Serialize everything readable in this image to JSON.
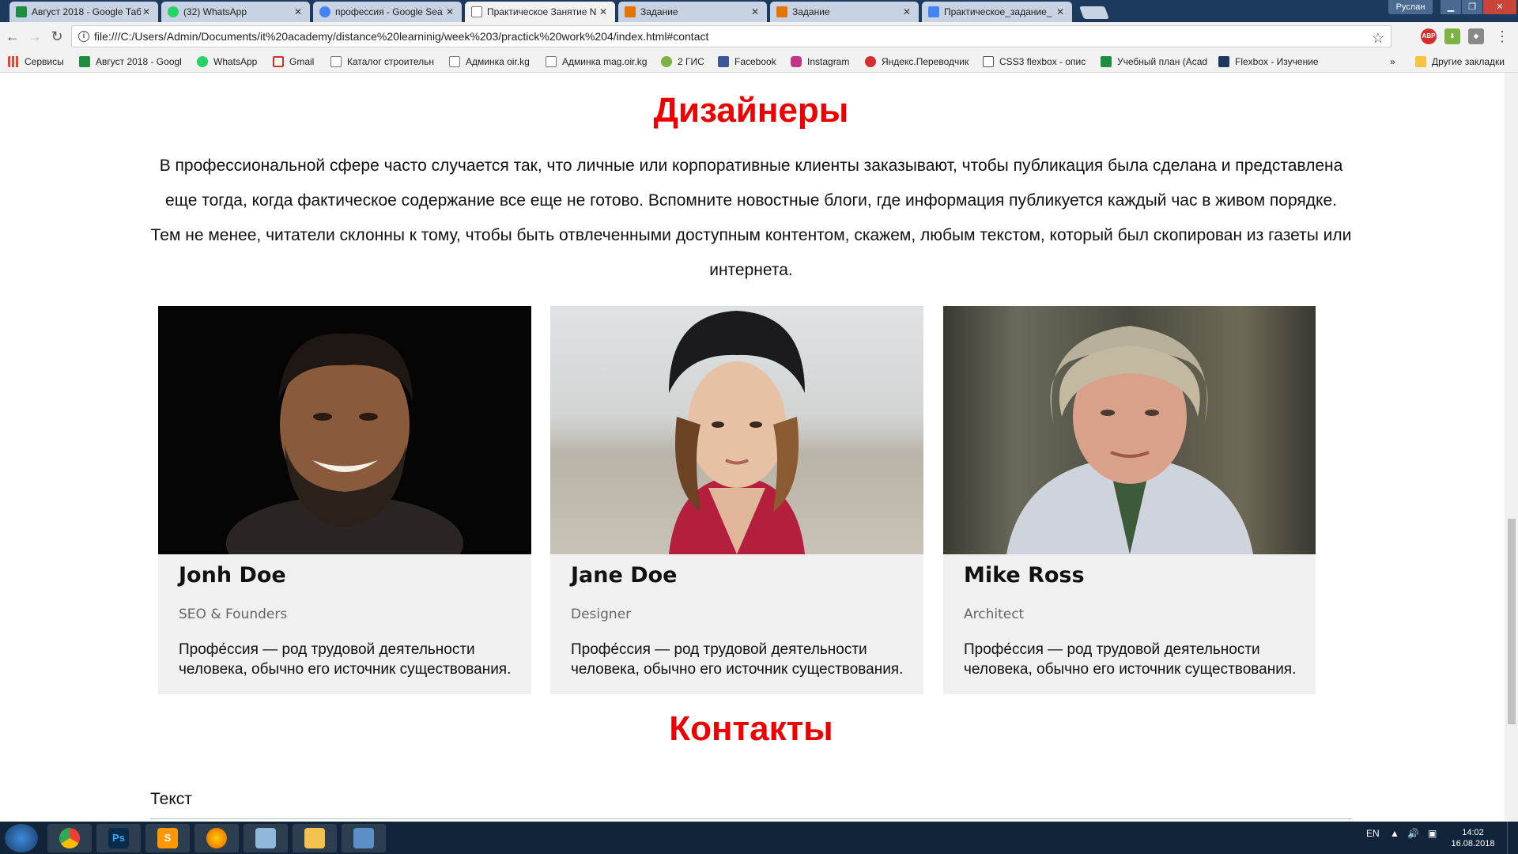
{
  "browser": {
    "tabs": [
      {
        "label": "Август 2018 - Google Таб",
        "favicon_color": "#1e8e3e"
      },
      {
        "label": "(32) WhatsApp",
        "favicon_color": "#25d366"
      },
      {
        "label": "профессия - Google Sea",
        "favicon_color": "#4285f4"
      },
      {
        "label": "Практическое Занятие N",
        "favicon_color": "#9aa0a6"
      },
      {
        "label": "Задание",
        "favicon_color": "#e37400"
      },
      {
        "label": "Задание",
        "favicon_color": "#e37400"
      },
      {
        "label": "Практическое_задание_",
        "favicon_color": "#4285f4"
      }
    ],
    "user": "Руслан",
    "url": "file:///C:/Users/Admin/Documents/it%20academy/distance%20learninig/week%203/practick%20work%204/index.html#contact",
    "bookmarks": [
      {
        "label": "Сервисы",
        "icon_color": "#ea4335"
      },
      {
        "label": "Август 2018 - Googl",
        "icon_color": "#1e8e3e"
      },
      {
        "label": "WhatsApp",
        "icon_color": "#25d366"
      },
      {
        "label": "Gmail",
        "icon_color": "#d93025"
      },
      {
        "label": "Каталог строительн",
        "icon_color": "#9aa0a6"
      },
      {
        "label": "Админка oir.kg",
        "icon_color": "#9aa0a6"
      },
      {
        "label": "Админка mag.oir.kg",
        "icon_color": "#9aa0a6"
      },
      {
        "label": "2 ГИС",
        "icon_color": "#7cb342"
      },
      {
        "label": "Facebook",
        "icon_color": "#3b5998"
      },
      {
        "label": "Instagram",
        "icon_color": "#c13584"
      },
      {
        "label": "Яндекс.Переводчик",
        "icon_color": "#d32f2f"
      },
      {
        "label": "CSS3 flexbox - опис",
        "icon_color": "#555555"
      },
      {
        "label": "Учебный план (Acad",
        "icon_color": "#1e8e3e"
      },
      {
        "label": "Flexbox - Изучение",
        "icon_color": "#1c3a5e"
      }
    ],
    "other_bookmarks": "Другие закладки",
    "more_bookmarks": "»"
  },
  "page": {
    "designers_title": "Дизайнеры",
    "intro": "В профессиональной сфере часто случается так, что личные или корпоративные клиенты заказывают, чтобы публикация была сделана и представлена еще тогда, когда фактическое содержание все еще не готово. Вспомните новостные блоги, где информация публикуется каждый час в живом порядке. Тем не менее, читатели склонны к тому, чтобы быть отвлеченными доступным контентом, скажем, любым текстом, который был скопирован из газеты или интернета.",
    "cards": [
      {
        "name": "Jonh Doe",
        "role": "SEO & Founders",
        "desc": "Профе́ссия — род трудовой деятельности человека, обычно его источник существования."
      },
      {
        "name": "Jane Doe",
        "role": "Designer",
        "desc": "Профе́ссия — род трудовой деятельности человека, обычно его источник существования."
      },
      {
        "name": "Mike Ross",
        "role": "Architect",
        "desc": "Профе́ссия — род трудовой деятельности человека, обычно его источник существования."
      }
    ],
    "contacts_title": "Контакты",
    "text_label": "Текст"
  },
  "taskbar": {
    "lang": "EN",
    "time": "14:02",
    "date": "16.08.2018",
    "apps": [
      "chrome",
      "photoshop",
      "sublime",
      "firefox",
      "paint",
      "explorer",
      "remote-desktop"
    ]
  },
  "colors": {
    "accent_red": "#ee0000",
    "card_bg": "#f0f0f0",
    "tabstrip_bg": "#1c3a5e",
    "taskbar_bg": "#12243a"
  }
}
